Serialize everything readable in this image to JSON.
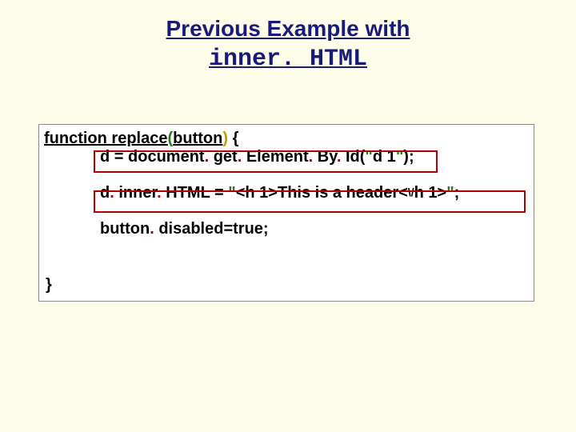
{
  "title_line1": "Previous Example with",
  "title_line2": "inner. HTML",
  "code": {
    "func_kw": "function replace",
    "paren_open": "(",
    "param": "button",
    "paren_close": ")",
    "brace_open": " {",
    "l2_a": "d = document",
    "l2_dot1": ". ",
    "l2_b": "get",
    "l2_dot2": ". ",
    "l2_c": "Element",
    "l2_dot3": ". ",
    "l2_d": "By",
    "l2_dot4": ". ",
    "l2_e": "Id(",
    "l2_q1": "\"",
    "l2_f": "d 1",
    "l2_q2": "\"",
    "l2_g": ");",
    "l3_a": "d",
    "l3_dot1": ". ",
    "l3_b": "inner",
    "l3_dot2": ". ",
    "l3_c": "HTML = ",
    "l3_q1": "\"",
    "l3_d": "<h 1>This is a header<",
    "l3_slash": "\\/",
    "l3_e": "h 1>",
    "l3_q2": "\"",
    "l3_f": ";",
    "l4_a": "button",
    "l4_dot1": ". ",
    "l4_b": "disabled=true;",
    "brace_close": "}"
  }
}
